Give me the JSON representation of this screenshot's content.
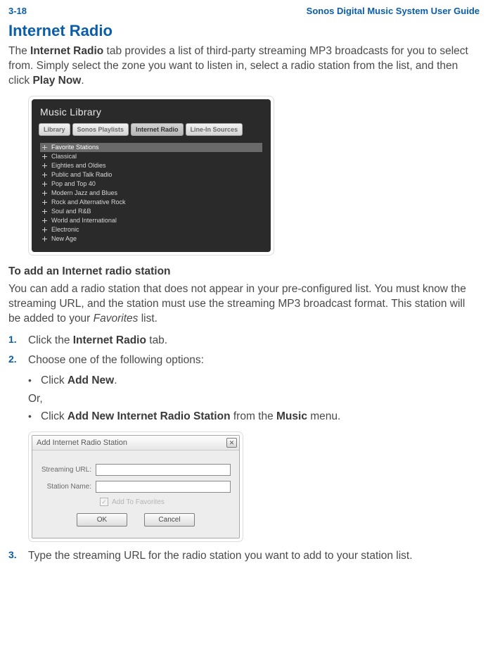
{
  "header": {
    "page_num": "3-18",
    "guide_title": "Sonos Digital Music System User Guide"
  },
  "h1": "Internet Radio",
  "intro": {
    "pre": "The ",
    "bold1": "Internet Radio",
    "mid": " tab provides a list of third-party streaming MP3 broadcasts for you to select from. Simply select the zone you want to listen in, select a radio station from the list, and then click ",
    "bold2": "Play Now",
    "end": "."
  },
  "music_library": {
    "title": "Music Library",
    "tabs": [
      "Library",
      "Sonos Playlists",
      "Internet Radio",
      "Line-In Sources"
    ],
    "active_tab_index": 2,
    "items": [
      "Favorite Stations",
      "Classical",
      "Eighties and Oldies",
      "Public and Talk Radio",
      "Pop and Top 40",
      "Modern Jazz and Blues",
      "Rock and Alternative Rock",
      "Soul and R&B",
      "World and International",
      "Electronic",
      "New Age"
    ],
    "selected_index": 0
  },
  "h2": "To add an Internet radio station",
  "p2": {
    "pre": "You can add a radio station that does not appear in your pre-configured list. You must know the streaming URL, and the station must use the streaming MP3 broadcast format. This station will be added to your ",
    "italic": "Favorites",
    "end": " list."
  },
  "steps": {
    "s1": {
      "num": "1.",
      "pre": "Click the ",
      "bold": "Internet Radio",
      "end": " tab."
    },
    "s2": {
      "num": "2.",
      "txt": "Choose one of the following options:"
    },
    "b1": {
      "pre": "Click ",
      "bold": "Add New",
      "end": "."
    },
    "or": "Or,",
    "b2": {
      "pre": "Click ",
      "bold1": "Add New Internet Radio Station",
      "mid": " from the ",
      "bold2": "Music",
      "end": " menu."
    },
    "s3": {
      "num": "3.",
      "txt": "Type the streaming URL for the radio station you want to add to your station list."
    }
  },
  "dialog": {
    "title": "Add Internet Radio Station",
    "url_label": "Streaming URL:",
    "name_label": "Station Name:",
    "fav_label": "Add To Favorites",
    "ok": "OK",
    "cancel": "Cancel"
  }
}
